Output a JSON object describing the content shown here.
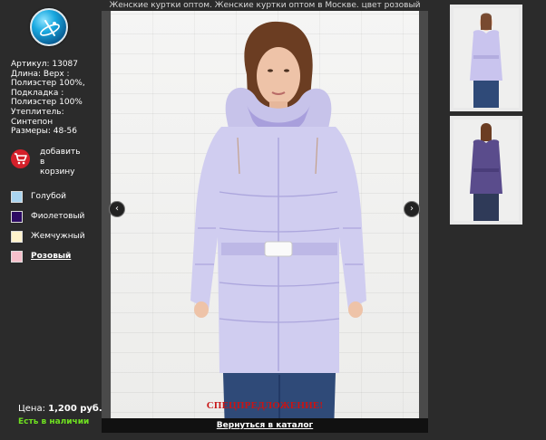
{
  "page_title": "Женские куртки оптом. Женские куртки оптом в Москве. цвет розовый",
  "product": {
    "specs": [
      "Артикул: 13087",
      "Длина: Верх :",
      "Полиэстер 100%,",
      "Подкладка :",
      "Полиэстер 100%",
      "Утеплитель:",
      "Синтепон",
      "Размеры: 48-56"
    ],
    "cart_label": [
      "добавить",
      "в",
      "корзину"
    ],
    "colors": [
      {
        "name": "Голубой",
        "hex": "#a9d4ef",
        "active": false
      },
      {
        "name": "Фиолетовый",
        "hex": "#2c0a63",
        "active": false
      },
      {
        "name": "Жемчужный",
        "hex": "#fff3cc",
        "active": false
      },
      {
        "name": "Розовый",
        "hex": "#f6c0cb",
        "active": true
      }
    ],
    "price_label": "Цена:",
    "price_value": "1,200 руб.",
    "stock_status": "Есть в наличии"
  },
  "viewer": {
    "promo_text": "СПЕЦПРЕДЛОЖЕНИЕ!",
    "back_link": "Вернуться в каталог",
    "prev_arrow": "‹",
    "next_arrow": "›"
  },
  "thumbnails": [
    {
      "name": "lavender jacket front",
      "color": "#c9c4ee"
    },
    {
      "name": "violet jacket back",
      "color": "#5a4c8c"
    }
  ],
  "colors_ui": {
    "background": "#2b2b2b",
    "accent_red": "#c81414",
    "stock_green": "#6fe020",
    "cart_red": "#d4202a"
  }
}
